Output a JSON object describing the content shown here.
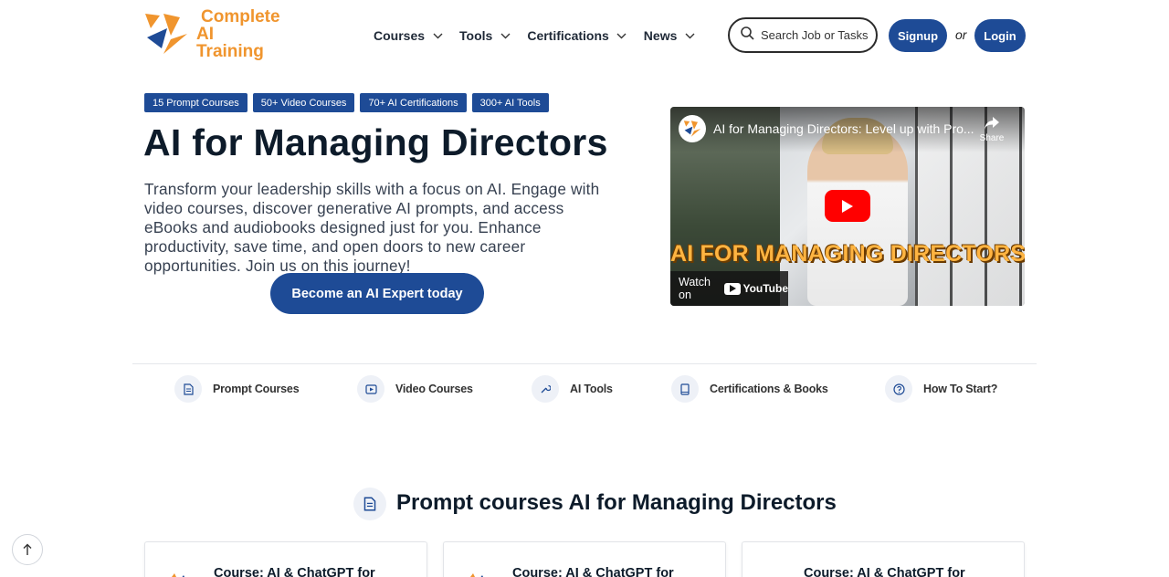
{
  "brand": {
    "line1": "Complete",
    "line2": "AI Training",
    "color": "#f0952e"
  },
  "nav": {
    "items": [
      {
        "label": "Courses"
      },
      {
        "label": "Tools"
      },
      {
        "label": "Certifications"
      },
      {
        "label": "News"
      }
    ],
    "search_placeholder": "Search Job or Tasks",
    "signup_label": "Signup",
    "or_label": "or",
    "login_label": "Login"
  },
  "hero": {
    "badges": [
      "15 Prompt Courses",
      "50+ Video Courses",
      "70+ AI Certifications",
      "300+ AI Tools"
    ],
    "title": "AI for Managing Directors",
    "description": "Transform your leadership skills with a focus on AI. Engage with video courses, discover generative AI prompts, and access eBooks and audiobooks designed just for you. Enhance productivity, save time, and open doors to new career opportunities. Join us on this journey!",
    "cta_label": "Become an AI Expert today"
  },
  "video": {
    "title": "AI for Managing Directors: Level up with Pro...",
    "share_label": "Share",
    "caption": "AI FOR MANAGING DIRECTORS",
    "watch_label": "Watch on",
    "youtube_label": "YouTube"
  },
  "categories": [
    {
      "label": "Prompt Courses",
      "icon": "document-icon"
    },
    {
      "label": "Video Courses",
      "icon": "play-icon"
    },
    {
      "label": "AI Tools",
      "icon": "wrench-icon"
    },
    {
      "label": "Certifications & Books",
      "icon": "book-icon"
    },
    {
      "label": "How To Start?",
      "icon": "question-icon"
    }
  ],
  "section": {
    "title": "Prompt courses AI for Managing Directors",
    "cards": [
      {
        "title": "Course: AI & ChatGPT for"
      },
      {
        "title": "Course: AI & ChatGPT for"
      },
      {
        "title": "Course: AI & ChatGPT for"
      }
    ]
  },
  "colors": {
    "primary": "#1e4b96",
    "accent": "#f0952e"
  }
}
